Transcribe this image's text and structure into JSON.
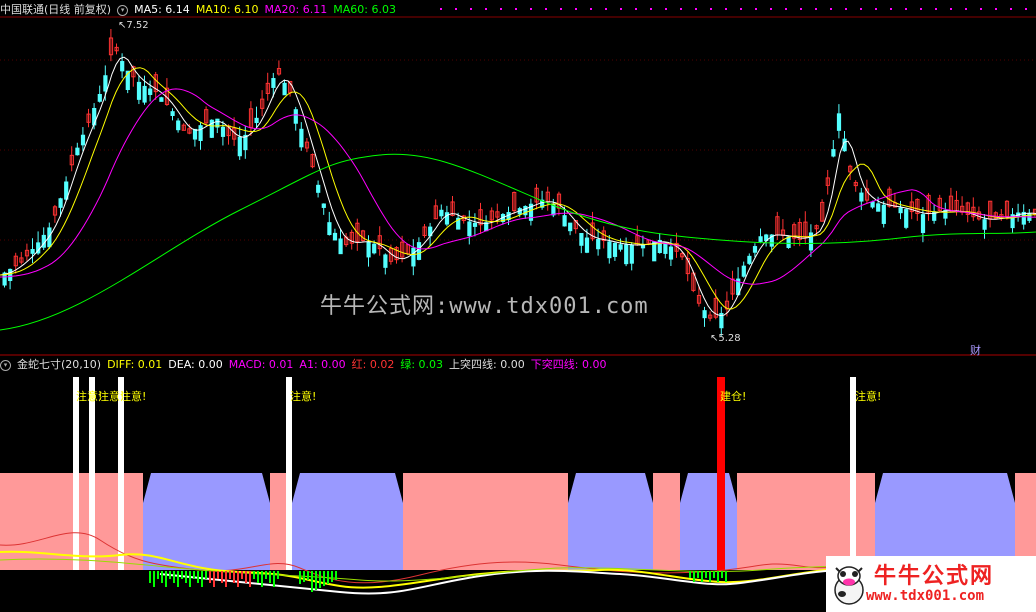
{
  "main_header": {
    "title": "中国联通(日线 前复权)",
    "ma5": "MA5: 6.14",
    "ma10": "MA10: 6.10",
    "ma20": "MA20: 6.11",
    "ma60": "MA60: 6.03"
  },
  "main_chart": {
    "high_label": "7.52",
    "low_label": "5.28",
    "watermark": "牛牛公式网:www.tdx001.com",
    "fin_marker": "财"
  },
  "indicator_header": {
    "name": "金蛇七寸(20,10)",
    "diff": "DIFF: 0.01",
    "dea": "DEA: 0.00",
    "macd": "MACD: 0.01",
    "a1": "A1: 0.00",
    "red": "红: 0.02",
    "green": "绿: 0.03",
    "up_break": "上突四线: 0.00",
    "down_break": "下突四线: 0.00"
  },
  "signals": {
    "attention_1": "注意!",
    "attention_2": "注意!",
    "attention_3": "注意!",
    "attention_4": "注意!",
    "attention_5": "注意!",
    "build": "建仓!"
  },
  "logo": {
    "title": "牛牛公式网",
    "url": "www.tdx001.com"
  },
  "colors": {
    "background": "#000000",
    "up_candle": "#ff3232",
    "down_candle": "#54ffff",
    "ma5": "#ffffff",
    "ma10": "#ffff00",
    "ma20": "#ff00ff",
    "ma60": "#00ff00",
    "pink_zone": "#ff9999",
    "blue_zone": "#9999ff",
    "signal_bar": "#ffffff",
    "build_bar": "#ff0000"
  },
  "icons": {
    "header_select": "circle-chevron-icon",
    "indicator_select": "circle-chevron-icon"
  }
}
